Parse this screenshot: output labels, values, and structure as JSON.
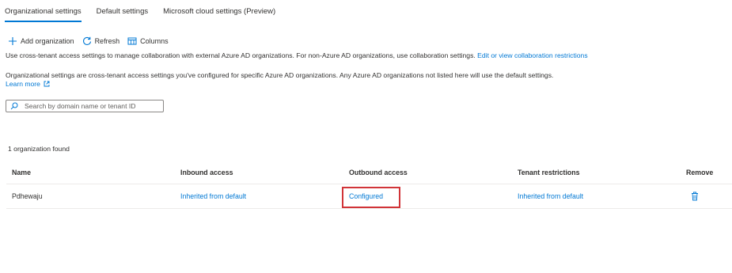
{
  "tabs": [
    {
      "label": "Organizational settings",
      "active": true
    },
    {
      "label": "Default settings",
      "active": false
    },
    {
      "label": "Microsoft cloud settings (Preview)",
      "active": false
    }
  ],
  "toolbar": {
    "add_label": "Add organization",
    "refresh_label": "Refresh",
    "columns_label": "Columns"
  },
  "info": {
    "line1_text": "Use cross-tenant access settings to manage collaboration with external Azure AD organizations. For non-Azure AD organizations, use collaboration settings.",
    "line1_link": "Edit or view collaboration restrictions",
    "line2_text": "Organizational settings are cross-tenant access settings you've configured for specific Azure AD organizations. Any Azure AD organizations not listed here will use the default settings.",
    "learn_more": "Learn more"
  },
  "search": {
    "placeholder": "Search by domain name or tenant ID",
    "value": ""
  },
  "result_count": "1 organization found",
  "table": {
    "columns": [
      "Name",
      "Inbound access",
      "Outbound access",
      "Tenant restrictions",
      "Remove"
    ],
    "rows": [
      {
        "name": "Pdhewaju",
        "inbound": "Inherited from default",
        "outbound": "Configured",
        "tenant_restrictions": "Inherited from default",
        "remove_icon": "trash-icon"
      }
    ]
  },
  "colors": {
    "accent": "#0078d4",
    "highlight": "#d13438",
    "text": "#323130"
  }
}
